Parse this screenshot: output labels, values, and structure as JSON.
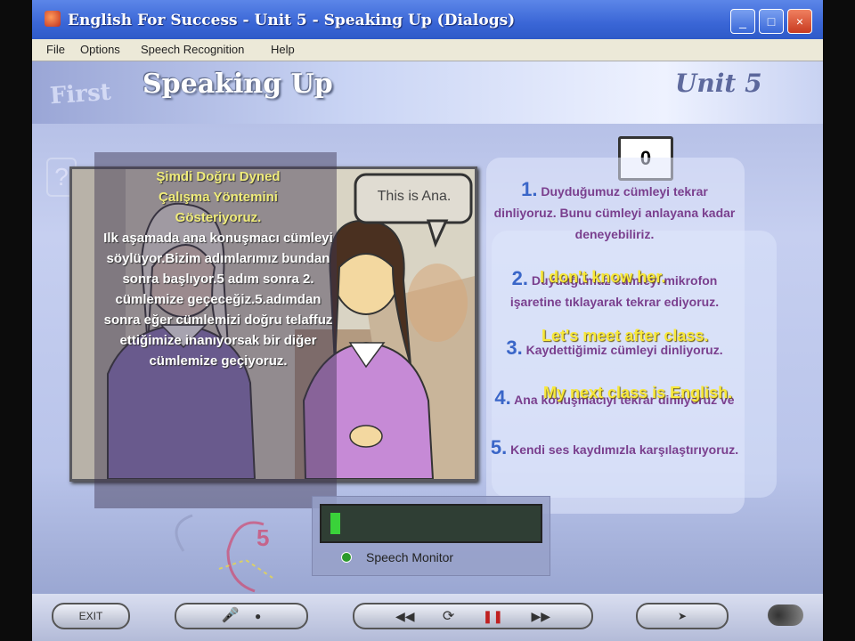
{
  "window": {
    "title": "English For Success  -  Unit 5  -  Speaking Up (Dialogs)",
    "controls": {
      "minimize": "_",
      "maximize": "□",
      "close": "×"
    }
  },
  "menu": [
    "File",
    "Options",
    "Speech Recognition",
    "Help"
  ],
  "header": {
    "title": "Speaking Up",
    "ghost_text": "First",
    "unit_label": "Unit 5"
  },
  "help_icon": "?",
  "counter": "0",
  "scene": {
    "speech_bubble": "This is Ana."
  },
  "turkish_overlay": {
    "yellow_lines": [
      "Şimdi Doğru Dyned",
      "Çalışma Yöntemini",
      "Gösteriyoruz."
    ],
    "white_text": "Ilk aşamada ana konuşmacı cümleyi söylüyor.Bizim adımlarımız bundan sonra başlıyor.5 adım sonra 2. cümlemize geçeceğiz.5.adımdan sonra eğer cümlemizi doğru telaffuz ettiğimize inanıyorsak bir diğer cümlemize geçiyoruz."
  },
  "steps": [
    {
      "num": "1.",
      "text": "Duyduğumuz cümleyi tekrar dinliyoruz. Bunu cümleyi anlayana kadar deneyebiliriz."
    },
    {
      "num": "2.",
      "text": "Duyduğumuz cümleyi mikrofon işaretine tıklayarak tekrar ediyoruz."
    },
    {
      "num": "3.",
      "text": "Kaydettiğimiz cümleyi dinliyoruz."
    },
    {
      "num": "4.",
      "text": "Ana konuşmacıyı tekrar dinliyoruz ve"
    },
    {
      "num": "5.",
      "text": "Kendi ses kaydımızla karşılaştırıyoruz."
    }
  ],
  "dialog_lines": [
    "I don't know her.",
    "Let's meet after class.",
    "My next class is English."
  ],
  "speech_monitor": {
    "label": "Speech Monitor",
    "level": 0.05
  },
  "annotation_number": "5",
  "bottom_bar": {
    "exit_label": "EXIT",
    "buttons": [
      "mic",
      "rewind",
      "repeat",
      "pause",
      "forward",
      "ahead"
    ]
  }
}
